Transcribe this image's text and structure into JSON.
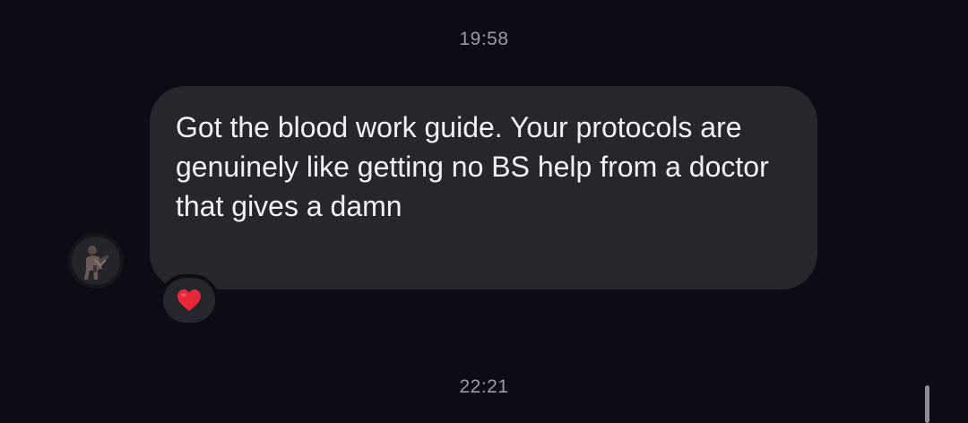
{
  "thread": {
    "timestamp_top": "19:58",
    "timestamp_bottom": "22:21"
  },
  "message": {
    "text": "Got the blood work guide. Your protocols are genuinely like getting no BS help from a doctor that gives a damn",
    "reaction_icon": "red-heart-icon"
  },
  "colors": {
    "background": "#0b0c14",
    "bubble": "#26272c",
    "text": "#f1f1f3",
    "timestamp": "#9a9ca6",
    "heart": "#e8283a"
  }
}
